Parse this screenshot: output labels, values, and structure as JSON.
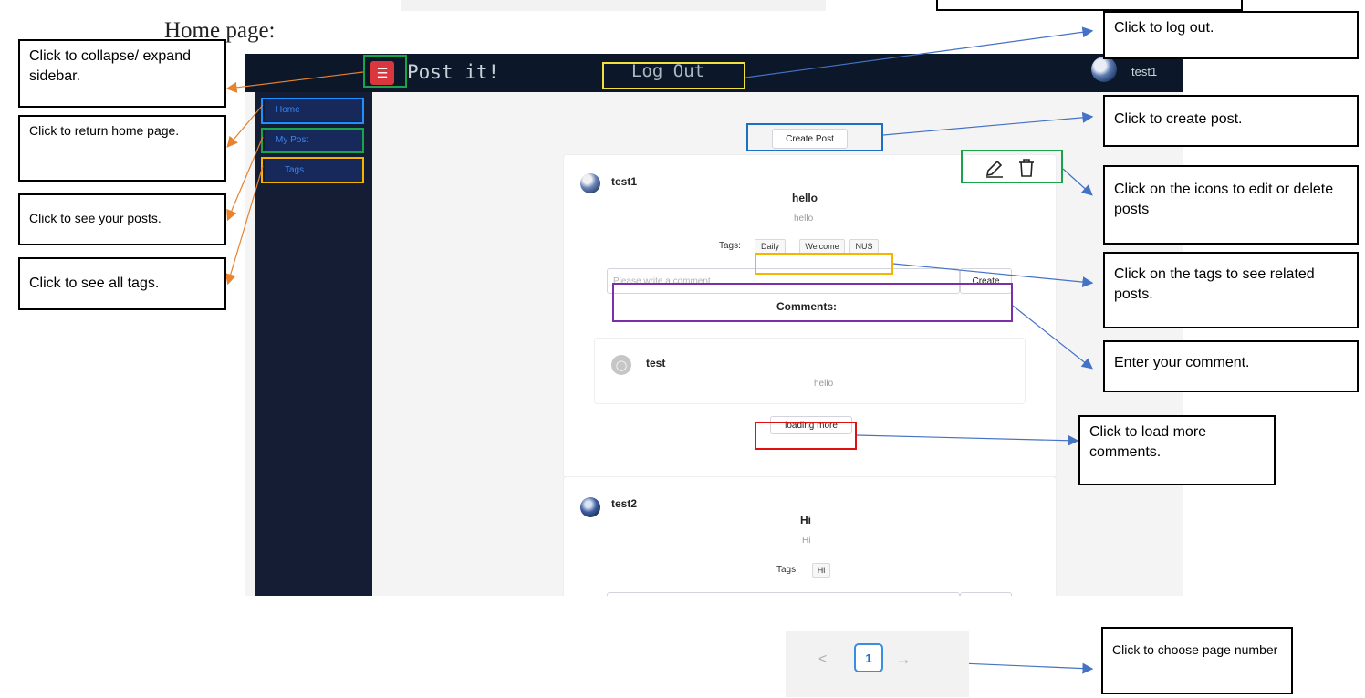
{
  "heading": "Home page:",
  "app": {
    "brand": "Post it!",
    "logout": "Log Out",
    "user": "test1",
    "sidebar": [
      {
        "label": "Home"
      },
      {
        "label": "My Post"
      },
      {
        "label": "Tags"
      }
    ],
    "create_post": "Create Post",
    "posts": [
      {
        "author": "test1",
        "title": "hello",
        "body": "hello",
        "tags_label": "Tags:",
        "tags": [
          "Daily",
          "Welcome",
          "NUS"
        ],
        "comment_placeholder": "Please write a comment...",
        "create_label": "Create",
        "comments_heading": "Comments:",
        "comments": [
          {
            "author": "test",
            "text": "hello"
          }
        ],
        "load_more": "loading more"
      },
      {
        "author": "test2",
        "title": "Hi",
        "body": "Hi",
        "tags_label": "Tags:",
        "tags": [
          "Hi"
        ]
      }
    ],
    "pagination": {
      "current": "1",
      "prev": "<",
      "next": "→"
    }
  },
  "callouts": {
    "collapse": "Click to collapse/ expand sidebar.",
    "home": "Click to return home page.",
    "my_posts": "Click to see your posts.",
    "tags": "Click to see all tags.",
    "logout": "Click to log out.",
    "create_post": "Click to create post.",
    "icons": "Click on the icons to edit or delete posts",
    "related": "Click on the tags to see related posts.",
    "comment": "Enter your comment.",
    "load_more": "Click to load more comments.",
    "page": "Click to choose page number"
  },
  "colors": {
    "orange_arrow": "#e8822c",
    "blue_arrow": "#4472c4",
    "topbar": "#0c1729",
    "sidebar": "#141d33"
  }
}
